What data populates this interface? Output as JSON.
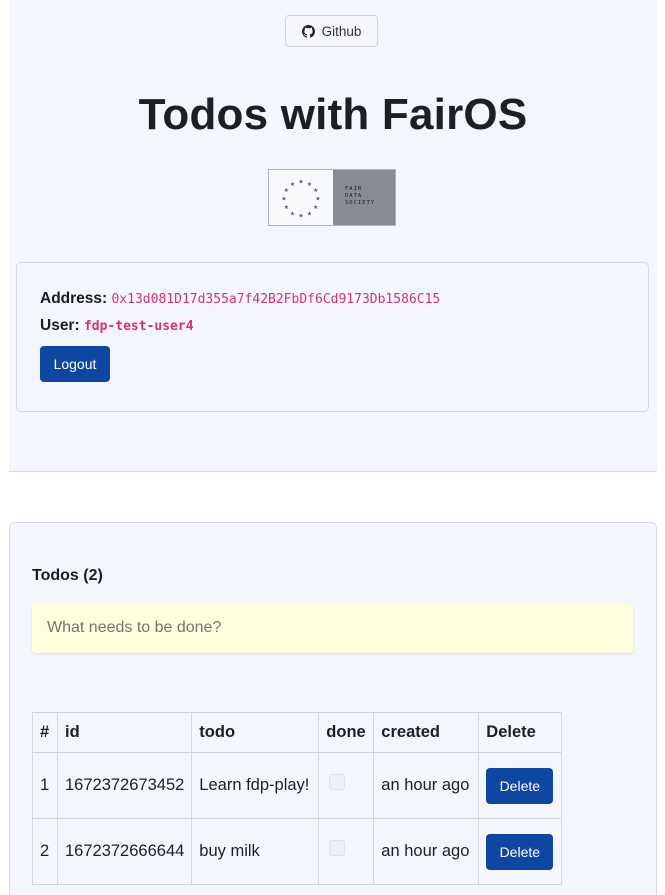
{
  "header": {
    "github_label": "Github",
    "title": "Todos with FairOS",
    "logo_text": "FAIR\nDATA\nSOCIETY"
  },
  "account": {
    "address_label": "Address:",
    "address": "0x13d081D17d355a7f42B2FbDf6Cd9173Db1586C15",
    "user_label": "User:",
    "user": "fdp-test-user4",
    "logout_label": "Logout"
  },
  "todos": {
    "heading": "Todos (2)",
    "input_placeholder": "What needs to be done?",
    "columns": [
      "#",
      "id",
      "todo",
      "done",
      "created",
      "Delete"
    ],
    "rows": [
      {
        "num": "1",
        "id": "1672372673452",
        "todo": "Learn fdp-play!",
        "created": "an hour ago",
        "delete_label": "Delete"
      },
      {
        "num": "2",
        "id": "1672372666644",
        "todo": "buy milk",
        "created": "an hour ago",
        "delete_label": "Delete"
      }
    ]
  },
  "colors": {
    "primary": "#0d47a1",
    "code": "#d6336c",
    "panel_bg": "#f4f6fd",
    "input_bg": "#fffedd"
  }
}
